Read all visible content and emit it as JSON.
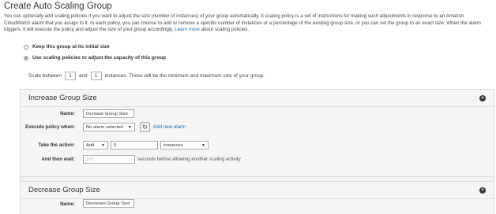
{
  "page": {
    "title": "Create Auto Scaling Group",
    "intro_line1": "You can optionally add scaling policies if you want to adjust the size (number of instances) of your group automatically. A scaling policy is a set of instructions for making such adjustments in response to an Amazon",
    "intro_line2": "CloudWatch alarm that you assign to it. In each policy, you can choose to add or remove a specific number of instances or a percentage of the existing group size, or you can set the group to an exact size. When the alarm",
    "intro_line3": "triggers, it will execute the policy and adjust the size of your group accordingly.",
    "learn_more": "Learn more",
    "intro_tail": "about scaling policies."
  },
  "options": {
    "keep_label": "Keep this group at its initial size",
    "keep_checked": false,
    "use_label": "Use scaling policies to adjust the capacity of this group",
    "use_checked": true
  },
  "scale": {
    "prefix": "Scale between",
    "min": "1",
    "and": "and",
    "max": "1",
    "suffix": "instances. These will be the minimum and maximum size of your group."
  },
  "increase": {
    "title": "Increase Group Size",
    "name_label": "Name:",
    "name_value": "Increase Group Size",
    "execute_label": "Execute policy when:",
    "alarm_selected": "No alarm selected",
    "add_alarm": "Add new alarm",
    "action_label": "Take the action:",
    "action_value": "Add",
    "amount": "0",
    "unit": "instances",
    "wait_label": "And then wait:",
    "wait_placeholder": "300",
    "wait_suffix": "seconds before allowing another scaling activity"
  },
  "decrease": {
    "title": "Decrease Group Size",
    "name_label": "Name:",
    "name_value": "Decrease Group Size"
  },
  "icons": {
    "close": "close-icon",
    "refresh": "refresh-icon"
  }
}
